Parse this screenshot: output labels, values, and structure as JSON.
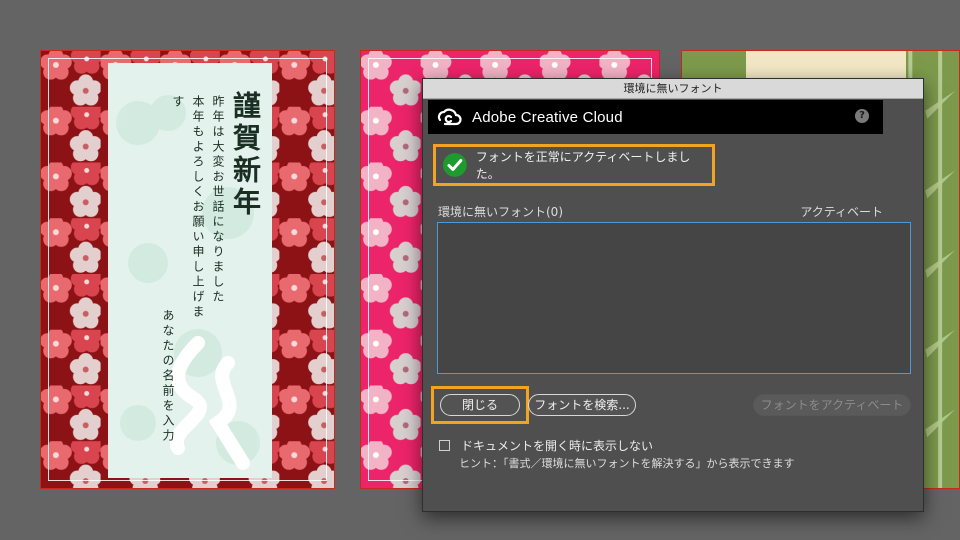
{
  "card_left": {
    "title": "謹賀新年",
    "lines": [
      "昨年は大変お世話になりました",
      "本年もよろしくお願い申し上げます"
    ],
    "name_placeholder": "あなたの名前を入力",
    "brush_glyph": "亥"
  },
  "dialog": {
    "window_title": "環境に無いフォント",
    "brand": "Adobe Creative Cloud",
    "help": "?",
    "status_message": "フォントを正常にアクティベートしました。",
    "list_label": "環境に無いフォント(0)",
    "column_label": "アクティベート",
    "buttons": {
      "close": "閉じる",
      "find": "フォントを検索...",
      "activate": "フォントをアクティベート"
    },
    "checkbox_label": "ドキュメントを開く時に表示しない",
    "checkbox_checked": false,
    "hint": "ヒント：「書式／環境に無いフォントを解決する」から表示できます"
  },
  "colors": {
    "highlight": "#f3a322",
    "card1_bg": "#8c1216",
    "card2_bg": "#ec2469",
    "card3_bg": "#7d9a4c",
    "success": "#1f9a2e"
  },
  "icons": [
    "creative-cloud-icon",
    "help-icon",
    "check-circle-icon"
  ]
}
